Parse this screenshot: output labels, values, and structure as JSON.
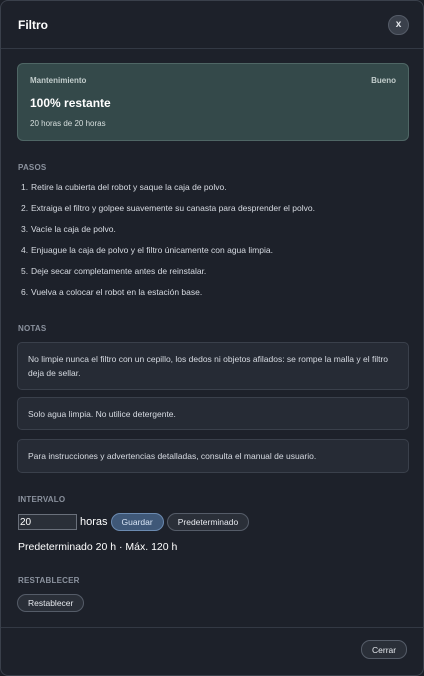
{
  "dialog": {
    "title": "Filtro",
    "close_icon_label": "x",
    "footer_close_label": "Cerrar"
  },
  "status": {
    "label": "Mantenimiento",
    "badge": "Bueno",
    "remaining": "100% restante",
    "hours": "20 horas de 20 horas"
  },
  "steps": {
    "heading": "PASOS",
    "items": [
      {
        "num": "1.",
        "text": "Retire la cubierta del robot y saque la caja de polvo."
      },
      {
        "num": "2.",
        "text": "Extraiga el filtro y golpee suavemente su canasta para desprender el polvo."
      },
      {
        "num": "3.",
        "text": "Vacíe la caja de polvo."
      },
      {
        "num": "4.",
        "text": "Enjuague la caja de polvo y el filtro únicamente con agua limpia."
      },
      {
        "num": "5.",
        "text": "Deje secar completamente antes de reinstalar."
      },
      {
        "num": "6.",
        "text": "Vuelva a colocar el robot en la estación base."
      }
    ]
  },
  "notes": {
    "heading": "NOTAS",
    "items": [
      "No limpie nunca el filtro con un cepillo, los dedos ni objetos afilados: se rompe la malla y el filtro deja de sellar.",
      "Solo agua limpia. No utilice detergente.",
      "Para instrucciones y advertencias detalladas, consulta el manual de usuario."
    ]
  },
  "interval": {
    "heading": "INTERVALO",
    "value": "20",
    "unit": "horas",
    "save_label": "Guardar",
    "default_label": "Predeterminado",
    "default_info": "Predeterminado 20 h · Máx. 120 h"
  },
  "reset": {
    "heading": "RESTABLECER",
    "button_label": "Restablecer"
  },
  "colors": {
    "status_card": "#34494a",
    "accent_button": "#3f5878"
  }
}
